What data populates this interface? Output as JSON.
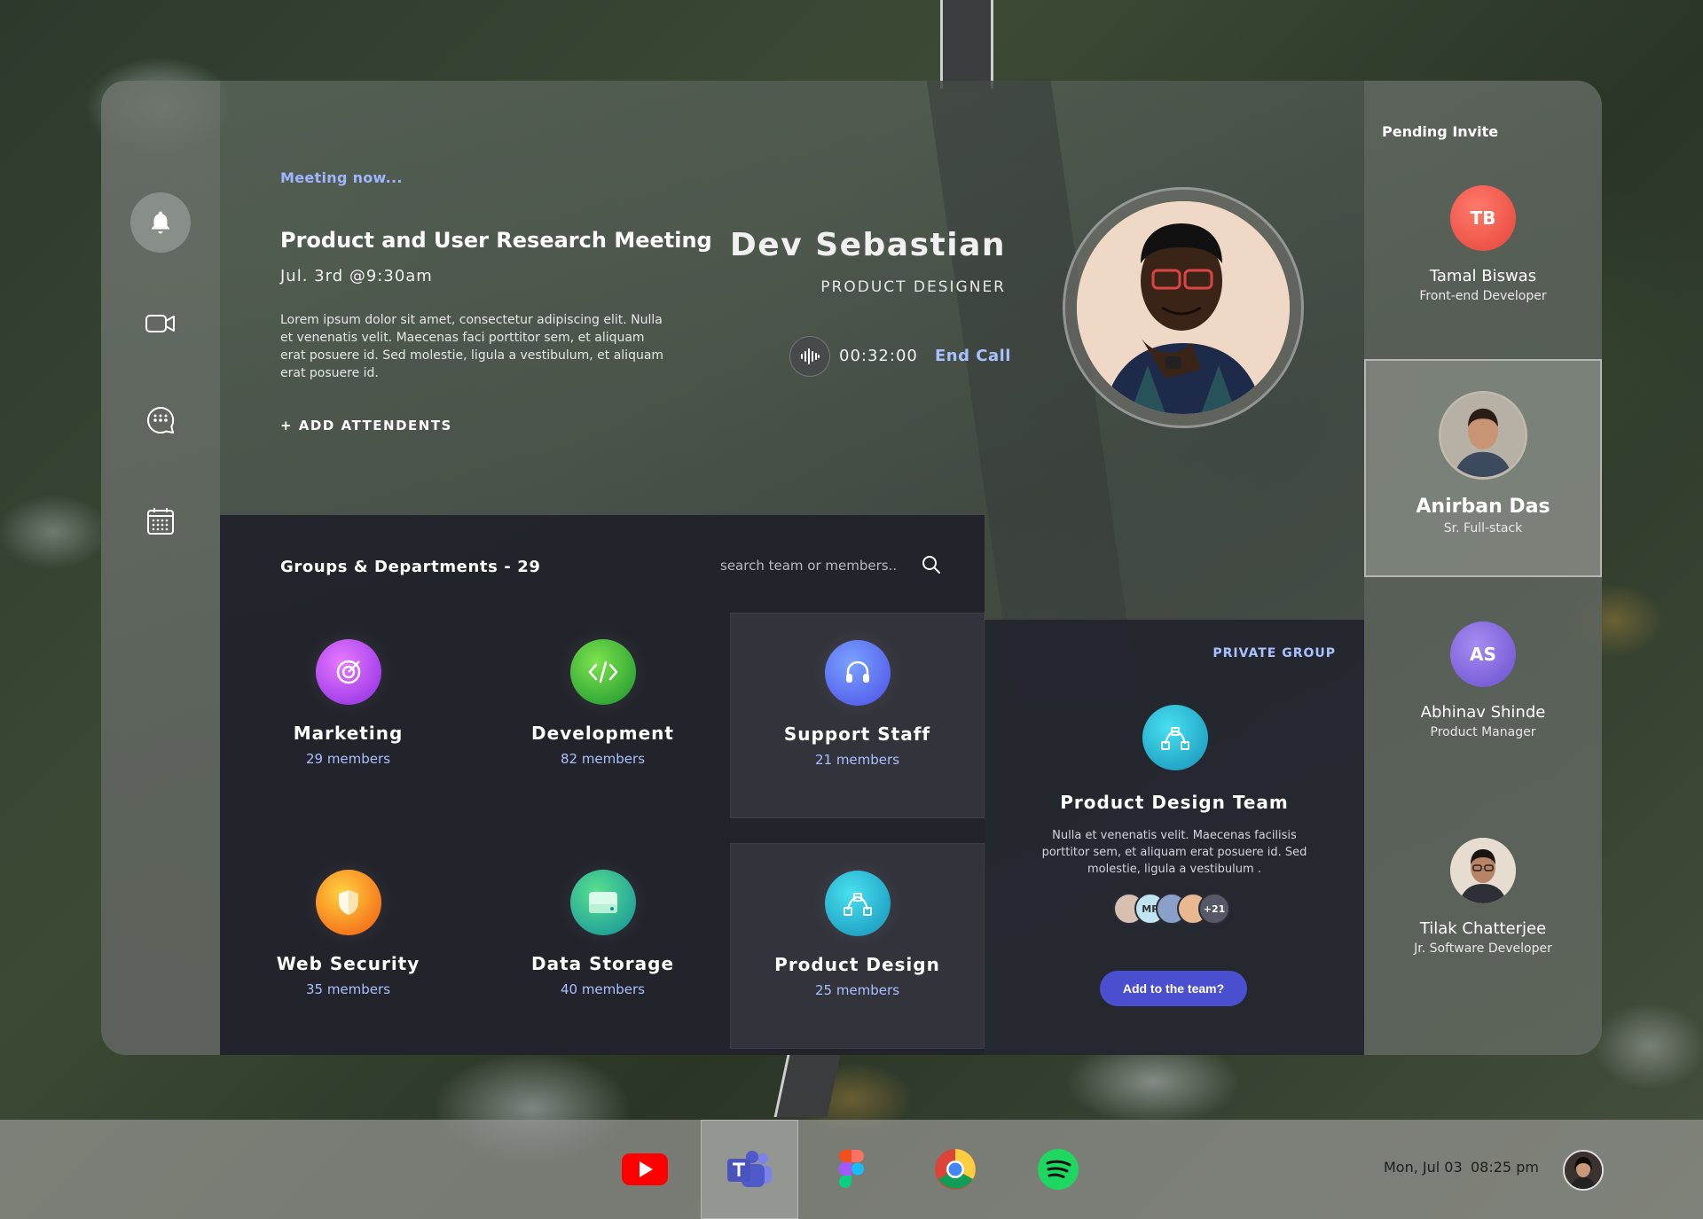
{
  "meeting": {
    "status": "Meeting now...",
    "title": "Product and User Research Meeting",
    "datetime": "Jul. 3rd  @9:30am",
    "description": "Lorem ipsum dolor sit amet, consectetur adipiscing elit. Nulla et venenatis velit. Maecenas faci porttitor sem, et aliquam erat posuere id. Sed molestie, ligula a vestibulum, et aliquam erat posuere id.",
    "add_attendees": "+ ADD ATTENDENTS"
  },
  "host": {
    "name": "Dev Sebastian",
    "role": "PRODUCT DESIGNER",
    "call_timer": "00:32:00",
    "end_call": "End Call"
  },
  "groups": {
    "title": "Groups & Departments - 29",
    "search_placeholder": "search team or members..",
    "items": [
      {
        "name": "Marketing",
        "count": "29 members",
        "icon": "target-icon",
        "color": "#c34cf0"
      },
      {
        "name": "Development",
        "count": "82 members",
        "icon": "code-icon",
        "color": "#3fc22a"
      },
      {
        "name": "Support Staff",
        "count": "21 members",
        "icon": "headset-icon",
        "color": "#5a7cff"
      },
      {
        "name": "Web Security",
        "count": "35 members",
        "icon": "shield-icon",
        "color": "#f7821c"
      },
      {
        "name": "Data Storage",
        "count": "40 members",
        "icon": "drive-icon",
        "color": "#1fb88a"
      },
      {
        "name": "Product Design",
        "count": "25 members",
        "icon": "vector-icon",
        "color": "#1aa7c9"
      }
    ]
  },
  "private_group": {
    "label": "PRIVATE GROUP",
    "title": "Product Design Team",
    "description": "Nulla et venenatis velit. Maecenas facilisis porttitor sem, et aliquam erat posuere id. Sed molestie, ligula a vestibulum .",
    "avatar_initials": "MR",
    "more_count": "+21",
    "button": "Add to the team?"
  },
  "pending": {
    "title": "Pending Invite",
    "invites": [
      {
        "initials": "TB",
        "name": "Tamal Biswas",
        "role": "Front-end Developer",
        "color": "#ef5b4f"
      },
      {
        "initials": "",
        "name": "Anirban Das",
        "role": "Sr. Full-stack",
        "color": "#6a5a4a"
      },
      {
        "initials": "AS",
        "name": "Abhinav Shinde",
        "role": "Product Manager",
        "color": "#7b62d4"
      },
      {
        "initials": "",
        "name": "Tilak Chatterjee",
        "role": "Jr. Software Developer",
        "color": "#c9b7a4"
      }
    ]
  },
  "taskbar": {
    "apps": [
      "youtube-icon",
      "teams-icon",
      "figma-icon",
      "chrome-icon",
      "spotify-icon"
    ],
    "date": "Mon, Jul 03",
    "time": "08:25 pm"
  }
}
